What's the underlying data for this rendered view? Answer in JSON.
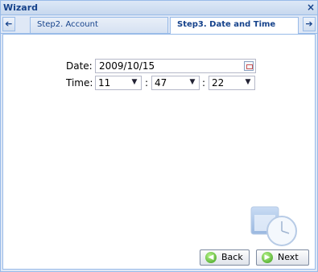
{
  "window": {
    "title": "Wizard",
    "close_icon": "×"
  },
  "tabs": {
    "scroll_left_icon": "➔",
    "scroll_right_icon": "➔",
    "items": [
      {
        "label": "Step2. Account",
        "active": false
      },
      {
        "label": "Step3. Date and Time",
        "active": true
      }
    ]
  },
  "form": {
    "date_label": "Date:",
    "date_value": "2009/10/15",
    "time_label": "Time:",
    "hour": "11",
    "minute": "47",
    "second": "22",
    "separator": ":"
  },
  "buttons": {
    "back": "Back",
    "next": "Next"
  },
  "colors": {
    "border": "#99bbe8",
    "title": "#15428b",
    "accent_green": "#3a9c1a"
  }
}
